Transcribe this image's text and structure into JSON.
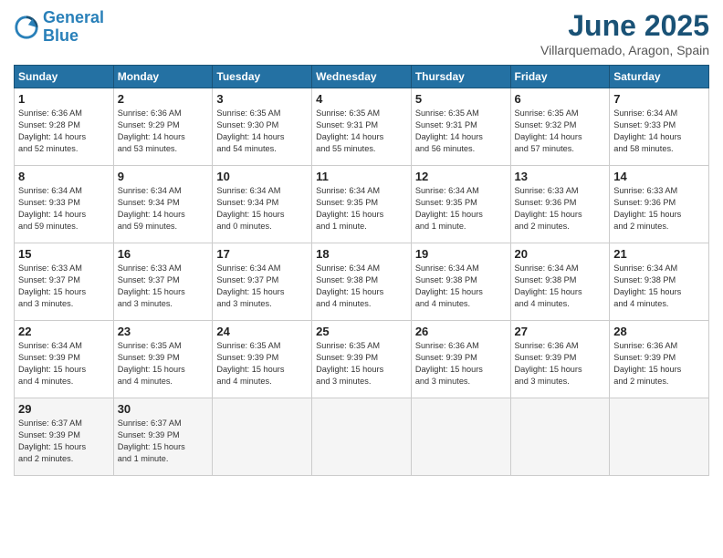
{
  "logo": {
    "line1": "General",
    "line2": "Blue"
  },
  "title": "June 2025",
  "subtitle": "Villarquemado, Aragon, Spain",
  "days_header": [
    "Sunday",
    "Monday",
    "Tuesday",
    "Wednesday",
    "Thursday",
    "Friday",
    "Saturday"
  ],
  "weeks": [
    [
      {
        "day": "1",
        "info": "Sunrise: 6:36 AM\nSunset: 9:28 PM\nDaylight: 14 hours\nand 52 minutes."
      },
      {
        "day": "2",
        "info": "Sunrise: 6:36 AM\nSunset: 9:29 PM\nDaylight: 14 hours\nand 53 minutes."
      },
      {
        "day": "3",
        "info": "Sunrise: 6:35 AM\nSunset: 9:30 PM\nDaylight: 14 hours\nand 54 minutes."
      },
      {
        "day": "4",
        "info": "Sunrise: 6:35 AM\nSunset: 9:31 PM\nDaylight: 14 hours\nand 55 minutes."
      },
      {
        "day": "5",
        "info": "Sunrise: 6:35 AM\nSunset: 9:31 PM\nDaylight: 14 hours\nand 56 minutes."
      },
      {
        "day": "6",
        "info": "Sunrise: 6:35 AM\nSunset: 9:32 PM\nDaylight: 14 hours\nand 57 minutes."
      },
      {
        "day": "7",
        "info": "Sunrise: 6:34 AM\nSunset: 9:33 PM\nDaylight: 14 hours\nand 58 minutes."
      }
    ],
    [
      {
        "day": "8",
        "info": "Sunrise: 6:34 AM\nSunset: 9:33 PM\nDaylight: 14 hours\nand 59 minutes."
      },
      {
        "day": "9",
        "info": "Sunrise: 6:34 AM\nSunset: 9:34 PM\nDaylight: 14 hours\nand 59 minutes."
      },
      {
        "day": "10",
        "info": "Sunrise: 6:34 AM\nSunset: 9:34 PM\nDaylight: 15 hours\nand 0 minutes."
      },
      {
        "day": "11",
        "info": "Sunrise: 6:34 AM\nSunset: 9:35 PM\nDaylight: 15 hours\nand 1 minute."
      },
      {
        "day": "12",
        "info": "Sunrise: 6:34 AM\nSunset: 9:35 PM\nDaylight: 15 hours\nand 1 minute."
      },
      {
        "day": "13",
        "info": "Sunrise: 6:33 AM\nSunset: 9:36 PM\nDaylight: 15 hours\nand 2 minutes."
      },
      {
        "day": "14",
        "info": "Sunrise: 6:33 AM\nSunset: 9:36 PM\nDaylight: 15 hours\nand 2 minutes."
      }
    ],
    [
      {
        "day": "15",
        "info": "Sunrise: 6:33 AM\nSunset: 9:37 PM\nDaylight: 15 hours\nand 3 minutes."
      },
      {
        "day": "16",
        "info": "Sunrise: 6:33 AM\nSunset: 9:37 PM\nDaylight: 15 hours\nand 3 minutes."
      },
      {
        "day": "17",
        "info": "Sunrise: 6:34 AM\nSunset: 9:37 PM\nDaylight: 15 hours\nand 3 minutes."
      },
      {
        "day": "18",
        "info": "Sunrise: 6:34 AM\nSunset: 9:38 PM\nDaylight: 15 hours\nand 4 minutes."
      },
      {
        "day": "19",
        "info": "Sunrise: 6:34 AM\nSunset: 9:38 PM\nDaylight: 15 hours\nand 4 minutes."
      },
      {
        "day": "20",
        "info": "Sunrise: 6:34 AM\nSunset: 9:38 PM\nDaylight: 15 hours\nand 4 minutes."
      },
      {
        "day": "21",
        "info": "Sunrise: 6:34 AM\nSunset: 9:38 PM\nDaylight: 15 hours\nand 4 minutes."
      }
    ],
    [
      {
        "day": "22",
        "info": "Sunrise: 6:34 AM\nSunset: 9:39 PM\nDaylight: 15 hours\nand 4 minutes."
      },
      {
        "day": "23",
        "info": "Sunrise: 6:35 AM\nSunset: 9:39 PM\nDaylight: 15 hours\nand 4 minutes."
      },
      {
        "day": "24",
        "info": "Sunrise: 6:35 AM\nSunset: 9:39 PM\nDaylight: 15 hours\nand 4 minutes."
      },
      {
        "day": "25",
        "info": "Sunrise: 6:35 AM\nSunset: 9:39 PM\nDaylight: 15 hours\nand 3 minutes."
      },
      {
        "day": "26",
        "info": "Sunrise: 6:36 AM\nSunset: 9:39 PM\nDaylight: 15 hours\nand 3 minutes."
      },
      {
        "day": "27",
        "info": "Sunrise: 6:36 AM\nSunset: 9:39 PM\nDaylight: 15 hours\nand 3 minutes."
      },
      {
        "day": "28",
        "info": "Sunrise: 6:36 AM\nSunset: 9:39 PM\nDaylight: 15 hours\nand 2 minutes."
      }
    ],
    [
      {
        "day": "29",
        "info": "Sunrise: 6:37 AM\nSunset: 9:39 PM\nDaylight: 15 hours\nand 2 minutes."
      },
      {
        "day": "30",
        "info": "Sunrise: 6:37 AM\nSunset: 9:39 PM\nDaylight: 15 hours\nand 1 minute."
      },
      {
        "day": "",
        "info": ""
      },
      {
        "day": "",
        "info": ""
      },
      {
        "day": "",
        "info": ""
      },
      {
        "day": "",
        "info": ""
      },
      {
        "day": "",
        "info": ""
      }
    ]
  ]
}
